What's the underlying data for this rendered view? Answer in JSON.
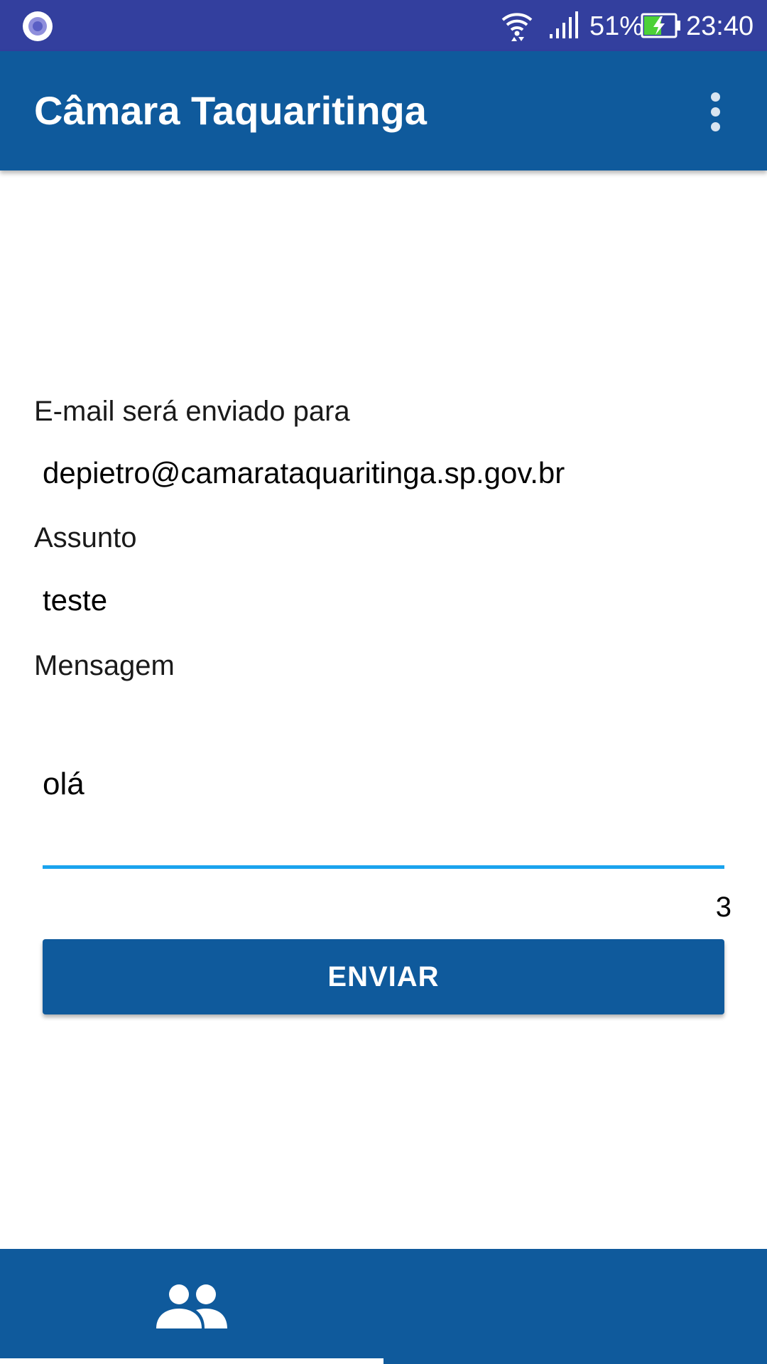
{
  "status_bar": {
    "battery_percent": "51%",
    "time": "23:40",
    "icons": [
      "app-notification-icon",
      "wifi-icon",
      "cell-signal-icon",
      "battery-charging-icon"
    ]
  },
  "app_bar": {
    "title": "Câmara Taquaritinga",
    "menu_icon": "more-vert-icon"
  },
  "form": {
    "to_label": "E-mail será enviado para",
    "to_value": "depietro@camarataquaritinga.sp.gov.br",
    "subject_label": "Assunto",
    "subject_value": "teste",
    "message_label": "Mensagem",
    "message_value": "olá",
    "char_count": "3",
    "send_label": "ENVIAR"
  },
  "bottom_nav": {
    "tabs": [
      {
        "icon": "people-icon",
        "selected": true
      },
      {
        "icon": "video-camera-icon",
        "selected": false
      }
    ]
  },
  "colors": {
    "status_bar": "#333f9e",
    "primary": "#0f5a9c",
    "accent": "#1aa3ee"
  }
}
